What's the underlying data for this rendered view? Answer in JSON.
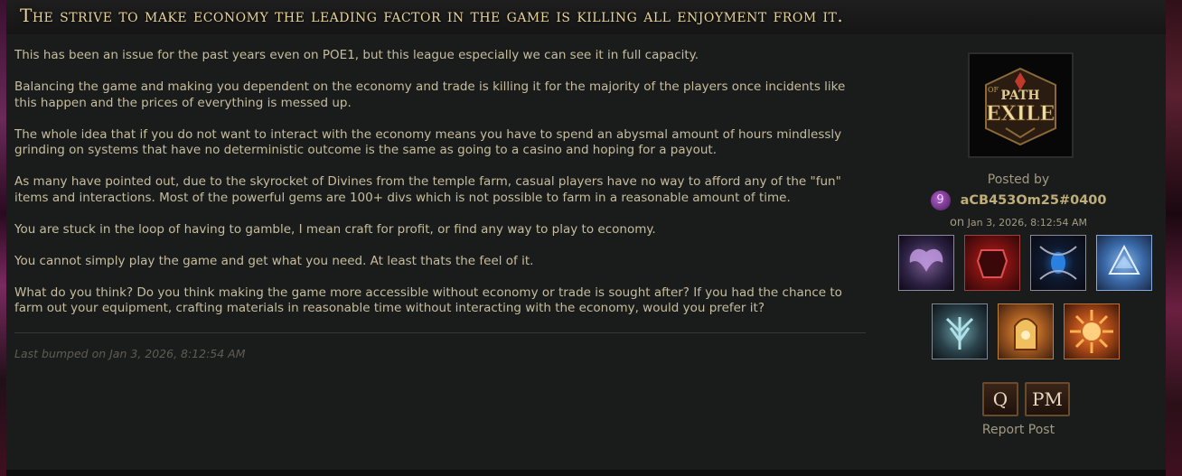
{
  "thread": {
    "title": "The strive to make economy the leading factor in the game is killing all enjoyment from it."
  },
  "post": {
    "paragraphs": [
      "This has been an issue for the past years even on POE1, but this league especially we can see it in full capacity.",
      "Balancing the game and making you dependent on the economy and trade is killing it for the majority of the players once incidents like this happen and the prices of everything is messed up.",
      "The whole idea that if you do not want to interact with the economy means you have to spend an abysmal amount of hours mindlessly grinding on systems that have no deterministic outcome is the same as going to a casino and hoping for a payout.",
      "As many have pointed out, due to the skyrocket of Divines from the temple farm, casual players have no way to afford any of the \"fun\" items and interactions. Most of the powerful gems are 100+ divs which is not possible to farm in a reasonable amount of time.",
      "You are stuck in the loop of having to gamble, I mean craft for profit, or find any way to play to economy.",
      "You cannot simply play the game and get what you need. At least thats the feel of it.",
      "What do you think? Do you think making the game more accessible without economy or trade is sought after? If you had the chance to farm out your equipment, crafting materials in reasonable time without interacting with the economy, would you prefer it?"
    ],
    "last_bumped": "Last bumped on Jan 3, 2026, 8:12:54 AM"
  },
  "author": {
    "avatar_lines": [
      "PATH",
      "EXILE"
    ],
    "avatar_of": "OF",
    "posted_by_label": "Posted by",
    "badge_number": "9",
    "name": "aCB453Om25#0400",
    "posted_on_prefix": "on",
    "posted_on": "Jan 3, 2026, 8:12:54 AM",
    "badges": [
      "wings-badge-icon",
      "armor-badge-icon",
      "eye-badge-icon",
      "crystal-badge-icon",
      "leaf-badge-icon",
      "shrine-badge-icon",
      "sunburst-badge-icon"
    ]
  },
  "actions": {
    "quote_label": "Q",
    "pm_label": "PM",
    "report_label": "Report Post"
  },
  "colors": {
    "title": "#e6d29a",
    "body_text": "#c7bd9e",
    "author": "#bfae78",
    "panel_bg": "#1a1c1b"
  }
}
